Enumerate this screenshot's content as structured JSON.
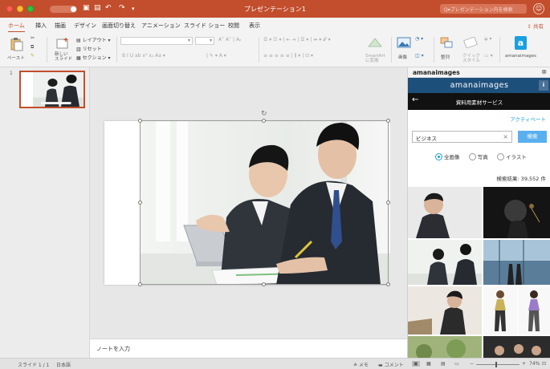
{
  "window": {
    "title": "プレゼンテーション1",
    "search_placeholder": "Q▾プレゼンテーション内を検索",
    "user_glyph": "☺"
  },
  "ribbon_tabs": [
    "ホーム",
    "挿入",
    "描画",
    "デザイン",
    "画面切り替え",
    "アニメーション",
    "スライド ショー",
    "校閲",
    "表示"
  ],
  "share_label": "⇪ 共有",
  "ribbon": {
    "paste": "ペースト",
    "new_slide": "新しい\nスライド",
    "layout": "レイアウト ▾",
    "reset": "リセット",
    "section": "セクション ▾",
    "font_buttons": "B  I  U  ab  x²  x₂  Aa ▾",
    "smartart": "SmartArt\nに変換",
    "picture": "画像",
    "arrange": "整列",
    "quick_styles": "クイック\nスタイル",
    "amanaimages": "amanaimages"
  },
  "thumbnails": {
    "slide_number": "1"
  },
  "notes": {
    "placeholder": "ノートを入力"
  },
  "pane": {
    "header_title": "amanaimages",
    "brand": "amanaimages",
    "info": "i",
    "back": "←",
    "nav_title": "資料用素材サービス",
    "activate": "アクティベート",
    "search_value": "ビジネス",
    "clear": "×",
    "search_button": "検索",
    "filters": [
      {
        "label": "全画像",
        "selected": true
      },
      {
        "label": "写真",
        "selected": false
      },
      {
        "label": "イラスト",
        "selected": false
      }
    ],
    "result_count": "検索結果: 39,552 件"
  },
  "statusbar": {
    "slide_info": "スライド 1 / 1",
    "language": "日本語",
    "notes": "≙ メモ",
    "comments": "▬ コメント",
    "zoom": "74%"
  },
  "colors": {
    "accent": "#c24e2d",
    "brand": "#1d4f7b",
    "link": "#1a9fe0"
  }
}
